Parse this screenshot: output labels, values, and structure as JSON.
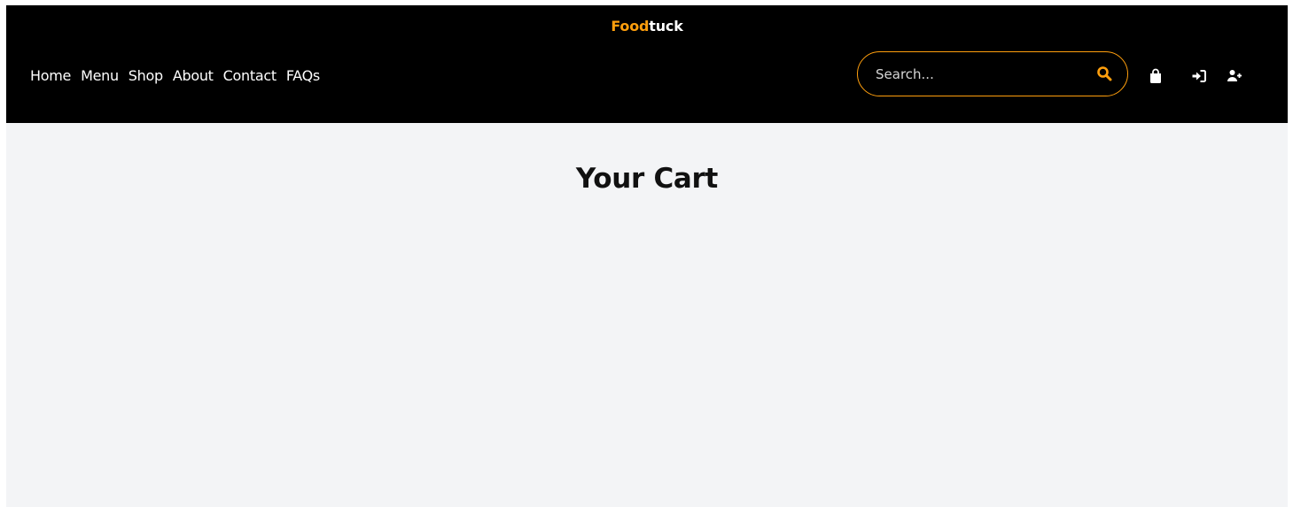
{
  "brand": {
    "name_part1": "Food",
    "name_part2": "tuck",
    "accent_color": "#ff9f0d"
  },
  "nav": {
    "links": [
      {
        "label": "Home"
      },
      {
        "label": "Menu"
      },
      {
        "label": "Shop"
      },
      {
        "label": "About"
      },
      {
        "label": "Contact"
      },
      {
        "label": "FAQs"
      }
    ]
  },
  "search": {
    "placeholder": "Search...",
    "value": "",
    "icon": "search-icon"
  },
  "header_icons": [
    {
      "icon": "shopping-bag-icon"
    },
    {
      "icon": "sign-in-icon"
    },
    {
      "icon": "user-plus-icon"
    }
  ],
  "main": {
    "title": "Your Cart"
  },
  "colors": {
    "navbar_bg": "#000000",
    "page_bg": "#f3f4f6",
    "accent": "#ff9f0d"
  }
}
